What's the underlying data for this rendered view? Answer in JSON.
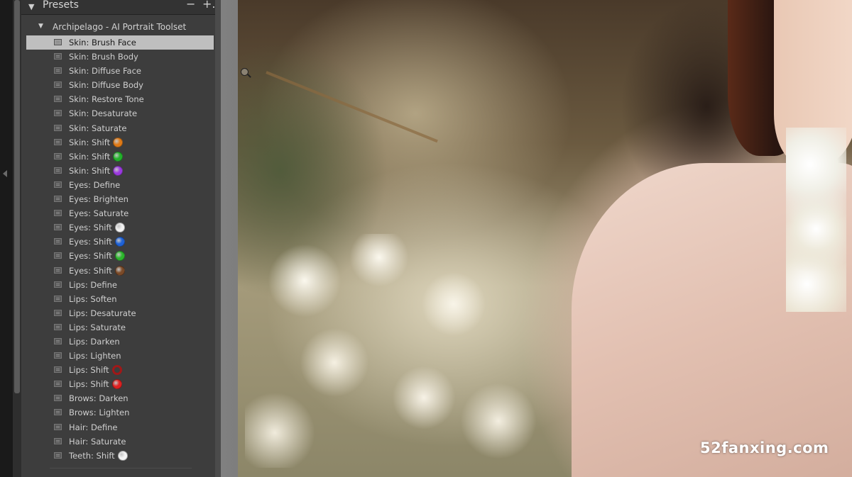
{
  "panel": {
    "title": "Presets",
    "minus_symbol": "−",
    "plus_symbol": "+.",
    "group_label": "Archipelago - AI Portrait Toolset"
  },
  "presets": [
    {
      "label": "Skin: Brush Face",
      "selected": true
    },
    {
      "label": "Skin: Brush Body"
    },
    {
      "label": "Skin: Diffuse Face"
    },
    {
      "label": "Skin: Diffuse Body"
    },
    {
      "label": "Skin: Restore Tone"
    },
    {
      "label": "Skin: Desaturate"
    },
    {
      "label": "Skin: Saturate"
    },
    {
      "label": "Skin: Shift",
      "dot": "#e07a16"
    },
    {
      "label": "Skin: Shift",
      "dot": "#22b22a"
    },
    {
      "label": "Skin: Shift",
      "dot": "#9b39e0"
    },
    {
      "label": "Eyes: Define"
    },
    {
      "label": "Eyes: Brighten"
    },
    {
      "label": "Eyes: Saturate"
    },
    {
      "label": "Eyes: Shift",
      "dot": "#f2f2f2"
    },
    {
      "label": "Eyes: Shift",
      "dot": "#1f62d6"
    },
    {
      "label": "Eyes: Shift",
      "dot": "#2cb62c"
    },
    {
      "label": "Eyes: Shift",
      "dot": "#7b4a28"
    },
    {
      "label": "Lips: Define"
    },
    {
      "label": "Lips: Soften"
    },
    {
      "label": "Lips: Desaturate"
    },
    {
      "label": "Lips: Saturate"
    },
    {
      "label": "Lips: Darken"
    },
    {
      "label": "Lips: Lighten"
    },
    {
      "label": "Lips: Shift",
      "dot": "#a01818",
      "ring": true
    },
    {
      "label": "Lips: Shift",
      "dot": "#e02020"
    },
    {
      "label": "Brows: Darken"
    },
    {
      "label": "Brows: Lighten"
    },
    {
      "label": "Hair: Define"
    },
    {
      "label": "Hair: Saturate"
    },
    {
      "label": "Teeth: Shift",
      "dot": "#f4f4f4"
    }
  ],
  "watermark": "52fanxing.com",
  "icons": {
    "collapse": "triangle-down-icon",
    "preset": "preset-doc-icon",
    "zoom": "zoom-cursor-icon"
  }
}
